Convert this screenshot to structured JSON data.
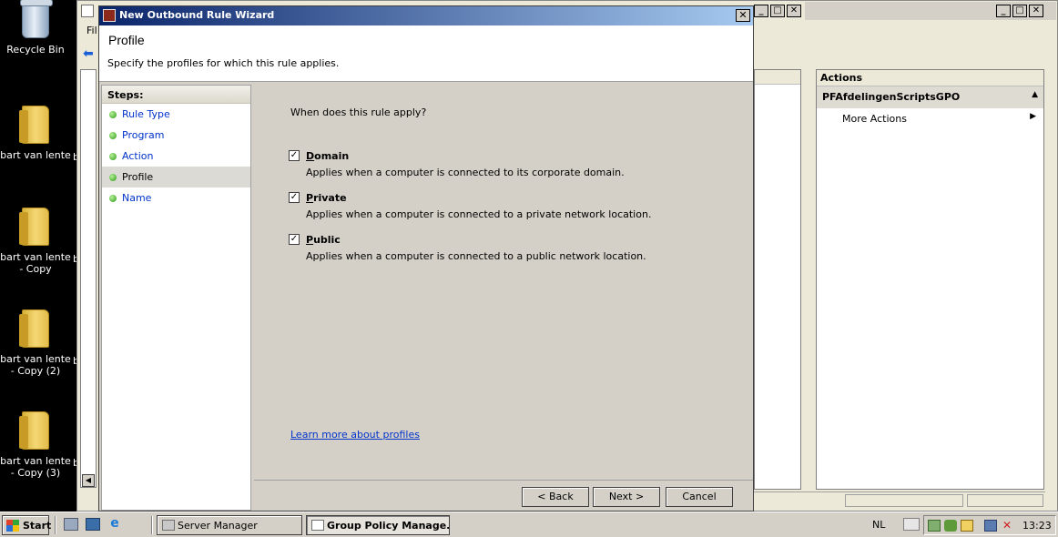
{
  "desktop": {
    "icons": [
      {
        "label": "Recycle Bin",
        "type": "recycle-bin"
      },
      {
        "label": "bart van lente",
        "type": "folder"
      },
      {
        "label": "bart van lente - Copy",
        "type": "folder"
      },
      {
        "label": "bart van lente - Copy (2)",
        "type": "folder"
      },
      {
        "label": "bart van lente - Copy (3)",
        "type": "folder"
      }
    ],
    "edge_letter": "b"
  },
  "background_window": {
    "menu_file_partial": "Fil",
    "actions": {
      "header": "Actions",
      "gpo_name": "PFAfdelingenScriptsGPO",
      "more_actions": "More Actions"
    }
  },
  "wizard": {
    "title": "New Outbound Rule Wizard",
    "close_symbol": "✕",
    "header_title": "Profile",
    "header_subtitle": "Specify the profiles for which this rule applies.",
    "steps_label": "Steps:",
    "steps": [
      {
        "label": "Rule Type",
        "current": false
      },
      {
        "label": "Program",
        "current": false
      },
      {
        "label": "Action",
        "current": false
      },
      {
        "label": "Profile",
        "current": true
      },
      {
        "label": "Name",
        "current": false
      }
    ],
    "question": "When does this rule apply?",
    "options": [
      {
        "first": "D",
        "rest": "omain",
        "checked": true,
        "description": "Applies when a computer is connected to its corporate domain."
      },
      {
        "first": "P",
        "rest": "rivate",
        "checked": true,
        "description": "Applies when a computer is connected to a private network location."
      },
      {
        "first": "P",
        "rest": "ublic",
        "checked": true,
        "description": "Applies when a computer is connected to a public network location."
      }
    ],
    "learn_more": "Learn more about profiles",
    "buttons": {
      "back": "< Back",
      "next": "Next >",
      "cancel": "Cancel"
    }
  },
  "taskbar": {
    "start": "Start",
    "tasks": [
      {
        "label": "Server Manager",
        "active": false
      },
      {
        "label": "Group Policy Manage...",
        "active": true
      }
    ],
    "language": "NL",
    "clock": "13:23"
  }
}
